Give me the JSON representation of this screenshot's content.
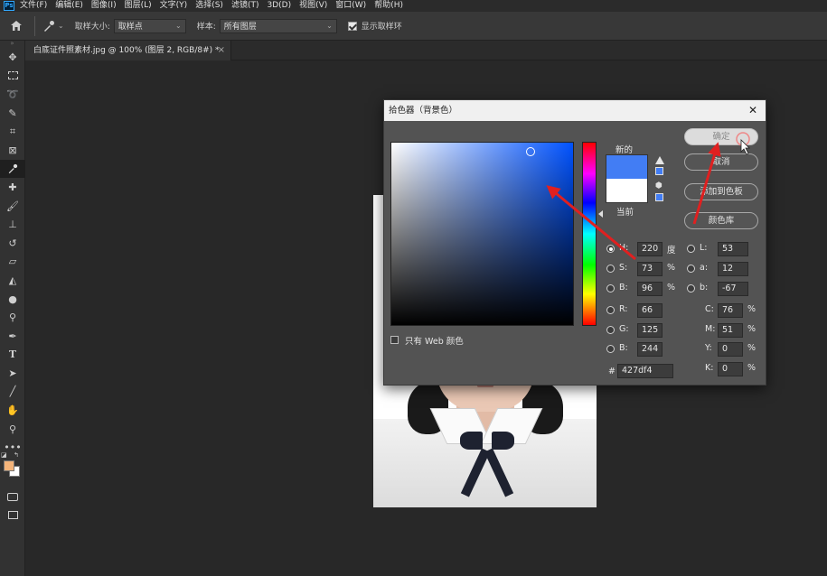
{
  "app": {
    "logo": "Ps"
  },
  "menu": [
    "文件(F)",
    "编辑(E)",
    "图像(I)",
    "图层(L)",
    "文字(Y)",
    "选择(S)",
    "滤镜(T)",
    "3D(D)",
    "视图(V)",
    "窗口(W)",
    "帮助(H)"
  ],
  "options": {
    "sample_size_label": "取样大小:",
    "sample_size_value": "取样点",
    "sample_label": "样本:",
    "sample_value": "所有图层",
    "show_ring_label": "显示取样环",
    "show_ring_checked": true
  },
  "document_tab": {
    "title": "白底证件照素材.jpg @ 100% (图层 2, RGB/8#) *",
    "close": "×"
  },
  "colors": {
    "foreground": "#f4b47a",
    "background": "#ffffff",
    "new_color": "#427df4",
    "current_color": "#ffffff"
  },
  "dialog": {
    "title": "拾色器（背景色）",
    "close": "✕",
    "new_label": "新的",
    "current_label": "当前",
    "web_only_label": "只有 Web 颜色",
    "buttons": {
      "ok": "确定",
      "cancel": "取消",
      "add_swatch": "添加到色板",
      "libraries": "颜色库"
    },
    "hsb": {
      "h": {
        "label": "H:",
        "value": "220",
        "unit": "度"
      },
      "s": {
        "label": "S:",
        "value": "73",
        "unit": "%"
      },
      "b": {
        "label": "B:",
        "value": "96",
        "unit": "%"
      }
    },
    "rgb": {
      "r": {
        "label": "R:",
        "value": "66"
      },
      "g": {
        "label": "G:",
        "value": "125"
      },
      "b": {
        "label": "B:",
        "value": "244"
      }
    },
    "lab": {
      "l": {
        "label": "L:",
        "value": "53"
      },
      "a": {
        "label": "a:",
        "value": "12"
      },
      "b": {
        "label": "b:",
        "value": "-67"
      }
    },
    "cmyk": {
      "c": {
        "label": "C:",
        "value": "76",
        "unit": "%"
      },
      "m": {
        "label": "M:",
        "value": "51",
        "unit": "%"
      },
      "y": {
        "label": "Y:",
        "value": "0",
        "unit": "%"
      },
      "k": {
        "label": "K:",
        "value": "0",
        "unit": "%"
      }
    },
    "hex": {
      "label": "#",
      "value": "427df4"
    }
  }
}
